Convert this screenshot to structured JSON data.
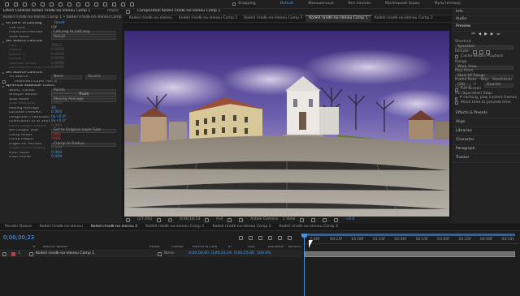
{
  "topbar": {
    "snapping": "Snapping",
    "workspaces": [
      "Default",
      "Изношенные",
      "Все панели",
      "Маленький экран",
      "Мультиплеер"
    ],
    "active_workspace": "Default"
  },
  "effect_controls": {
    "tab_label": "Effect Controls Kodeil rirodk-no-sleneu Comp 1",
    "tab2": "Projec",
    "layer_line": "Kodeil rirodk-no-sleneu Comp 1 • Kodeil rirodk-no-sleneu Comp 1",
    "rows": [
      {
        "label": "VR Lens To LatLong",
        "value": "Reset",
        "style": "head"
      },
      {
        "label": "Use GPU",
        "value": "Off",
        "style": "norm"
      },
      {
        "label": "Projection Method",
        "value": "LatLong to LatLong",
        "style": "dd"
      },
      {
        "label": "View Mode",
        "value": "Result",
        "style": "dd"
      },
      {
        "label": "Set Source Controls",
        "value": "",
        "style": "head"
      },
      {
        "label": "FOV",
        "value": "360.0",
        "style": "dim"
      },
      {
        "label": "Radius",
        "value": "0.0000",
        "style": "dim"
      },
      {
        "label": "Center X",
        "value": "0.0000",
        "style": "dim"
      },
      {
        "label": "Center Y",
        "value": "0.0000",
        "style": "dim"
      },
      {
        "label": "Latitude Offset",
        "value": "0.0000",
        "style": "dim"
      },
      {
        "label": "Lens Radius (Unit FOV)",
        "value": "0.0000",
        "style": "dim"
      },
      {
        "label": "Set Source Controls",
        "value": "",
        "style": "head"
      },
      {
        "label": "VR Source",
        "value": "None",
        "value2": "Source",
        "style": "dd2"
      },
      {
        "label": "Maximum Layer Pan X/Y Scale",
        "value": "",
        "style": "chk"
      },
      {
        "label": "Spherical Stabilizer Controls",
        "value": "",
        "style": "head"
      },
      {
        "label": "Select Tracker",
        "value": "Points",
        "style": "dd"
      },
      {
        "label": "Analyze Motion",
        "value": "Track",
        "style": "btn"
      },
      {
        "label": "Stab Mode",
        "value": "Moving Average",
        "style": "dd"
      },
      {
        "label": "Stab Multiplier",
        "value": "0.000",
        "style": "dim"
      },
      {
        "label": "Moving Average",
        "value": "40",
        "style": "blue"
      },
      {
        "label": "Latitude (-90x90)",
        "value": "0.000",
        "style": "blue"
      },
      {
        "label": "Longitude (-180x180)",
        "value": "0x+0.0°",
        "style": "blue"
      },
      {
        "label": "Orientation (0 to 360)",
        "value": "0x+0.0°",
        "style": "blue"
      },
      {
        "label": "Focal Length Divider",
        "value": "0.000",
        "style": "dim"
      },
      {
        "label": "Set Output Size",
        "value": "Set to Original Layer Size",
        "style": "dd"
      },
      {
        "label": "Comp Width",
        "value": "0000",
        "style": "red"
      },
      {
        "label": "Comp Height",
        "value": "0000",
        "style": "red"
      },
      {
        "label": "Edges Fill Method",
        "value": "Clamp to Radius",
        "style": "dd"
      },
      {
        "label": "Edges Anti-Aliasing",
        "value": "0.000",
        "style": "dim"
      },
      {
        "label": "Filter Ratio",
        "value": "0.000",
        "style": "blue"
      },
      {
        "label": "Filter Profile",
        "value": "0.000",
        "style": "blue"
      }
    ]
  },
  "composition": {
    "header": "Composition Kodeil rirodk-no-sleneu Comp 1",
    "tabs": [
      "Kodeil rirodk-no-sleneu",
      "Kodeil rirodk-no-sleneu Comp 2",
      "Kodeil rirodk-no-sleneu Comp 3",
      "Kodeil rirodk-no-sleneu Comp 1",
      "Kodeil rirodk-no-sleneu Comp 2"
    ],
    "active_tab": 3,
    "footer": {
      "zoom": "(27.4%)",
      "timecode": "0;00;18;13",
      "resolution": "Full",
      "camera": "Active Camera",
      "views": "1 View",
      "exposure": "+0.0"
    }
  },
  "right_panel": {
    "info": "Info",
    "audio": "Audio",
    "preview": "Preview",
    "shortcut_label": "Shortcut",
    "shortcut_value": "Spacebar",
    "include": "Include:",
    "cache_label": "Cache Before Playback",
    "range_label": "Range",
    "range_value": "Work Area",
    "play_from_label": "Play From",
    "play_from_value": "Start Of Range",
    "frame_rate_label": "Frame Rate",
    "skip_label": "Skip",
    "resolution_label": "Resolution",
    "frame_rate_value": "(30)",
    "skip_value": "0",
    "resolution_value": "Quarter",
    "full_screen": "Full Screen",
    "on_stop_label": "On (Spacebar) Stop:",
    "on_stop_1": "If caching, play cached frames",
    "on_stop_2": "Move time to preview time",
    "panels": [
      "Effects & Presets",
      "Align",
      "Libraries",
      "Character",
      "Paragraph",
      "Tracker"
    ]
  },
  "timeline": {
    "tabs": [
      "Render Queue",
      "Kodeil rirodk-no-sleneu",
      "Kodeil rirodk-no-sleneu 2",
      "Kodeil rirodk-no-sleneu Comp 1",
      "Kodeil rirodk-no-sleneu Comp 2",
      "Kodeil rirodk-no-sleneu Comp 3"
    ],
    "active_tab": 2,
    "timecode": "0;00;00;23",
    "columns": [
      "#",
      "Source Name",
      "Mode",
      "TrkMat",
      "Parent & Link",
      "In",
      "Out",
      "Duration",
      "Stretch"
    ],
    "layer": {
      "num": "1",
      "name": "Kodeil rirodk-no-sleneu Comp 1",
      "parent": "None",
      "in": "0;00;00;00",
      "out": "0;00;24;29",
      "duration": "0;00;25;00",
      "stretch": "100.0%"
    },
    "ruler": [
      "0:00f",
      "00:15f",
      "01:00f",
      "01:15f",
      "02:00f",
      "02:15f",
      "03:00f",
      "03:15f",
      "04:00f",
      "04:15f"
    ]
  },
  "colors": {
    "accent": "#4a8fd9",
    "layer_bar": "#6d6d6d",
    "label_red": "#b44242"
  }
}
